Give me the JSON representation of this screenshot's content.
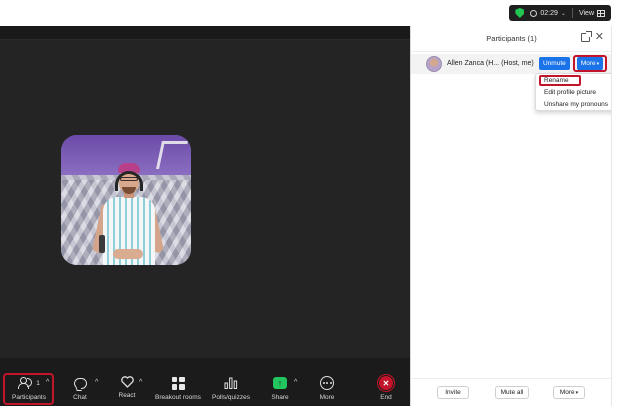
{
  "status": {
    "timer": "02:29",
    "view_label": "View"
  },
  "meeting": {
    "participant_tile": "video-tile"
  },
  "toolbar": {
    "participants_label": "Participants",
    "participants_count": "1",
    "chat_label": "Chat",
    "react_label": "React",
    "breakout_label": "Breakout rooms",
    "polls_label": "Polls/quizzes",
    "share_label": "Share",
    "more_label": "More",
    "end_label": "End"
  },
  "panel": {
    "title": "Participants (1)",
    "participant": {
      "name": "Allen Zanca (H...  (Host, me)",
      "unmute_label": "Unmute",
      "more_label": "More"
    },
    "menu": {
      "items": [
        "Rename",
        "Edit profile picture",
        "Unshare my pronouns"
      ]
    },
    "footer": {
      "invite_label": "Invite",
      "mute_all_label": "Mute all",
      "more_label": "More"
    }
  },
  "colors": {
    "highlight": "#c4142b",
    "accent": "#1a73e8",
    "share": "#22c55e",
    "meeting_bg": "#242424"
  }
}
